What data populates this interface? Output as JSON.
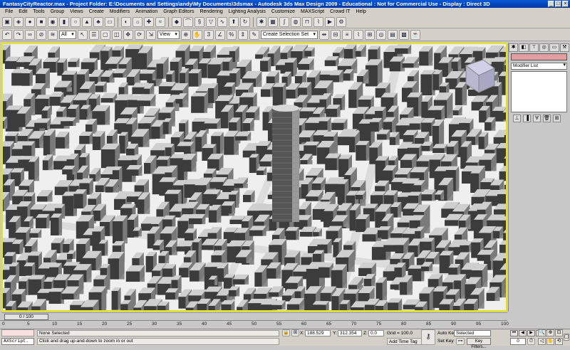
{
  "window": {
    "title": "FantasyCityReactor.max    - Project Folder: E:\\Documents and Settings\\andy\\My Documents\\3dsmax     - Autodesk 3ds Max Design 2009   - Educational : Not for Commercial Use     - Display : Direct 3D"
  },
  "menu": [
    "File",
    "Edit",
    "Tools",
    "Group",
    "Views",
    "Create",
    "Modifiers",
    "Animation",
    "Graph Editors",
    "Rendering",
    "Lighting Analysis",
    "Customize",
    "MAXScript",
    "Crowd IT",
    "Help"
  ],
  "toolbar": {
    "filter_value": "All",
    "ref_coord_value": "View",
    "named_selection_placeholder": "Create Selection Set"
  },
  "command_panel": {
    "modifier_list_label": "Modifier List",
    "swatch_color": "#e1a0a0"
  },
  "timeline": {
    "frame_readout": "0 / 100",
    "ticks": [
      "0",
      "5",
      "10",
      "15",
      "20",
      "25",
      "30",
      "35",
      "40",
      "45",
      "50",
      "55",
      "60",
      "65",
      "70",
      "75",
      "80",
      "85",
      "90",
      "95",
      "100"
    ]
  },
  "status": {
    "maxscript_label": "AXScript.",
    "selection_text": "None Selected",
    "prompt_text": "Click and drag up-and-down to zoom in or out",
    "x_label": "X:",
    "x_value": "188.529",
    "y_label": "Y:",
    "y_value": "312.354",
    "z_label": "Z:",
    "z_value": "0.0",
    "grid_text": "Grid = 100.0",
    "add_time_tag": "Add Time Tag",
    "auto_key": "Auto Key",
    "set_key": "Set Key",
    "selected_value": "Selected",
    "key_filters": "Key Filters...",
    "current_frame": "0"
  },
  "viewport": {
    "active_border_color": "#e6e600"
  }
}
